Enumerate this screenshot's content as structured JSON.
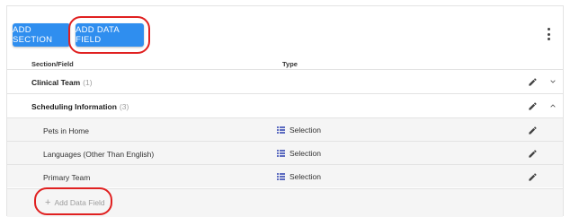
{
  "toolbar": {
    "add_section_label": "ADD SECTION",
    "add_data_field_label": "ADD DATA FIELD",
    "more_icon": "more-vert-icon"
  },
  "table": {
    "columns": [
      "Section/Field",
      "Type"
    ],
    "sections": [
      {
        "name": "Clinical Team",
        "count": "(1)",
        "expanded": false,
        "fields": []
      },
      {
        "name": "Scheduling Information",
        "count": "(3)",
        "expanded": true,
        "fields": [
          {
            "name": "Pets in Home",
            "type": "Selection"
          },
          {
            "name": "Languages (Other Than English)",
            "type": "Selection"
          },
          {
            "name": "Primary Team",
            "type": "Selection"
          }
        ]
      }
    ],
    "add_data_field_link": "Add Data Field"
  },
  "colors": {
    "primary_button": "#2f8eef",
    "annotation": "#e02020",
    "row_alt": "#f5f5f5",
    "list_icon": "#5c6bc0"
  }
}
